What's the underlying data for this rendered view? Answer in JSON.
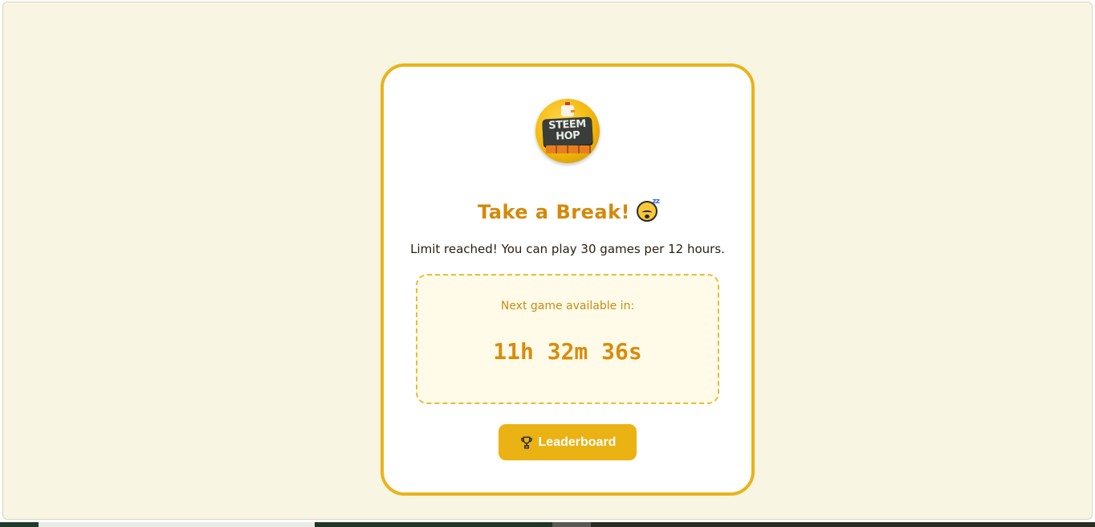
{
  "app": {
    "logo": {
      "line1": "STEEM",
      "line2": "HOP",
      "icon": "steem-hop-logo"
    }
  },
  "break_card": {
    "title": "Take a Break!",
    "title_emoji": "sleeping-face-icon",
    "message": "Limit reached! You can play 30 games per 12 hours.",
    "timer": {
      "label": "Next game available in:",
      "value": "11h 32m 36s"
    },
    "leaderboard_button": {
      "icon": "trophy-icon",
      "label": "Leaderboard"
    }
  },
  "colors": {
    "accent": "#eab213",
    "title": "#d4890a",
    "page_bg": "#f8f5e3",
    "timer_bg": "#fffbe8"
  }
}
